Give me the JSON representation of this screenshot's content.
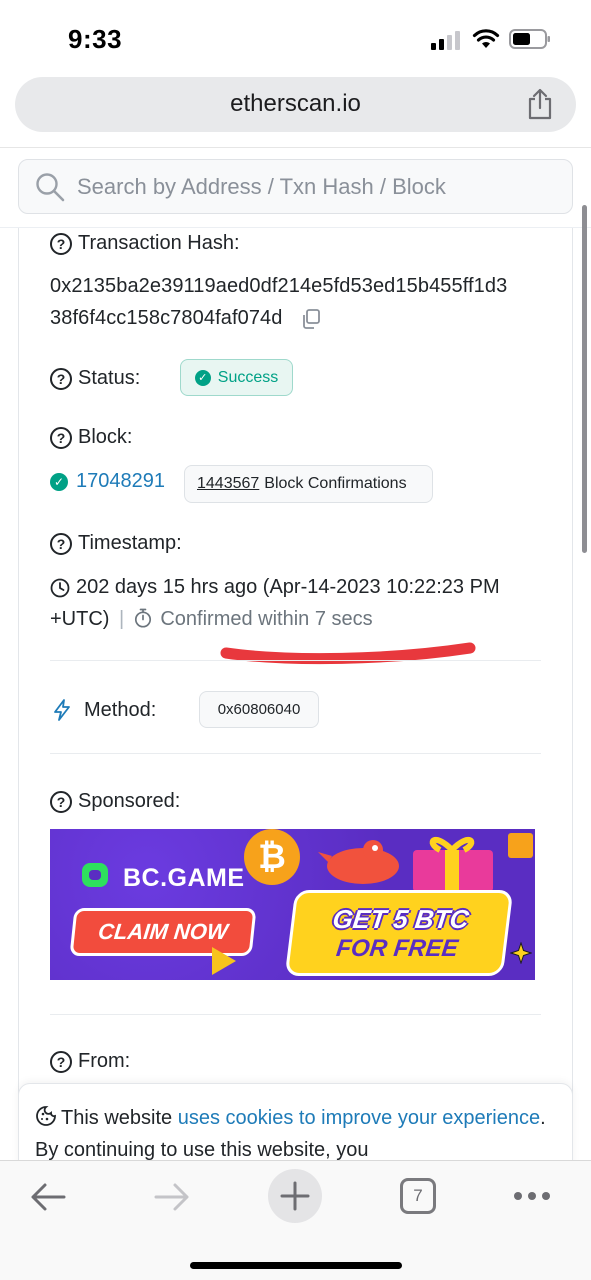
{
  "status_bar": {
    "time": "9:33"
  },
  "browser": {
    "domain": "etherscan.io",
    "tab_count": "7"
  },
  "search": {
    "placeholder": "Search by Address / Txn Hash / Block"
  },
  "transaction": {
    "hash_label": "Transaction Hash:",
    "hash_line1": "0x2135ba2e39119aed0df214e5fd53ed15b455ff1d3",
    "hash_line2": "38f6f4cc158c7804faf074d",
    "status_label": "Status:",
    "status_value": "Success",
    "block_label": "Block:",
    "block_number": "17048291",
    "confirmations_count": "1443567",
    "confirmations_text": "Block Confirmations",
    "timestamp_label": "Timestamp:",
    "timestamp_line1": "202 days 15 hrs ago (Apr-14-2023 10:22:23 PM",
    "timestamp_line2": "+UTC)",
    "timestamp_sep": "|",
    "confirmed_within": "Confirmed within 7 secs",
    "method_label": "Method:",
    "method_value": "0x60806040",
    "sponsored_label": "Sponsored:",
    "from_label": "From:"
  },
  "ad": {
    "brand": "BC.GAME",
    "cta": "CLAIM NOW",
    "headline_1": "GET 5 BTC",
    "headline_2": "FOR FREE",
    "coin_symbol": "₿"
  },
  "cookie_banner": {
    "text_1": "This website ",
    "link": "uses cookies to improve your experience",
    "text_2": ". By continuing to use this website, you"
  },
  "colors": {
    "accent_link": "#1e7bb8",
    "success": "#00a186",
    "annotation_red": "#e8383d",
    "ad_purple": "#5a2dc2"
  }
}
